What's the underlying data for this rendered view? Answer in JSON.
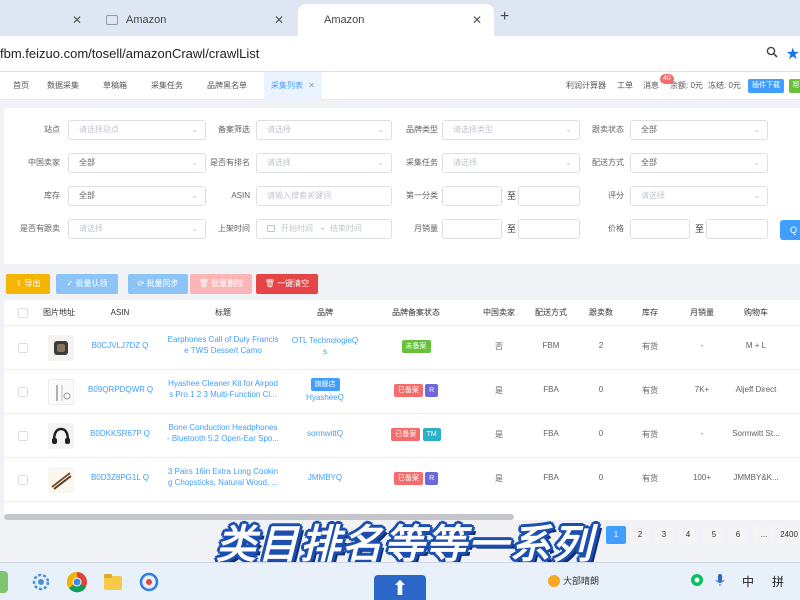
{
  "browser": {
    "tabs": [
      {
        "title": "",
        "close": "✕"
      },
      {
        "title": "Amazon",
        "close": "✕"
      },
      {
        "title": "Amazon",
        "close": "✕"
      }
    ],
    "new_tab": "+",
    "url": "fbm.feizuo.com/tosell/amazonCrawl/crawlList"
  },
  "nav": {
    "tabs": [
      "首页",
      "数据采集",
      "草稿箱",
      "采集任务",
      "品牌黑名单",
      "采集列表"
    ],
    "active_close": "✕",
    "profit_calc": "利润计算器",
    "orders": "工单",
    "messages": "消息",
    "message_badge": "40",
    "balance": "余额: 0元",
    "frozen": "冻结: 0元",
    "download_btn": "插件下载",
    "help_btn": "帮"
  },
  "filters": {
    "row1": [
      {
        "label": "站点",
        "placeholder": "请选择站点"
      },
      {
        "label": "备案筛选",
        "placeholder": "请选择"
      },
      {
        "label": "品牌类型",
        "placeholder": "请选择类型"
      },
      {
        "label": "跟卖状态",
        "value": "全部"
      }
    ],
    "row2": [
      {
        "label": "中国卖家",
        "value": "全部"
      },
      {
        "label": "是否有排名",
        "placeholder": "请选择"
      },
      {
        "label": "采集任务",
        "placeholder": "请选择"
      },
      {
        "label": "配送方式",
        "value": "全部"
      }
    ],
    "row3": [
      {
        "label": "库存",
        "value": "全部"
      },
      {
        "label": "ASIN",
        "placeholder": "请输入搜索关键词"
      },
      {
        "label": "第一分类",
        "sep": "至"
      },
      {
        "label": "评分",
        "placeholder": "请选择"
      }
    ],
    "row4": [
      {
        "label": "是否有跟卖",
        "placeholder": "请选择"
      },
      {
        "label": "上架时间",
        "start": "开始时间",
        "dash": "-",
        "end": "结束时间"
      },
      {
        "label": "月销量",
        "sep": "至"
      },
      {
        "label": "价格",
        "sep": "至"
      }
    ],
    "search_icon": "Q"
  },
  "actions": {
    "export": "导出",
    "batch_claim": "批量认领",
    "batch_sync": "批量同步",
    "batch_delete": "批量删除",
    "clear_all": "一键清空",
    "colors": {
      "export": "#f5b400",
      "claim": "#8cc4f8",
      "sync": "#8cc4f8",
      "delete": "#fab6b6",
      "clear": "#e64545"
    }
  },
  "table": {
    "headers": [
      "图片地址",
      "ASIN",
      "标题",
      "品牌",
      "品牌备案状态",
      "中国卖家",
      "配送方式",
      "跟卖数",
      "库存",
      "月销量",
      "购物车"
    ],
    "rows": [
      {
        "asin": "B0CJVLJ7DZ",
        "title1": "Earphones Call of Duty Francis",
        "title2": "e TWS Dessert Camo",
        "brand_line1": "OTL Technologie",
        "brand_line2": "s",
        "brand_tag": "",
        "status": "未备案",
        "status_color": "green",
        "extra_tag": "",
        "cn_seller": "否",
        "ship": "FBM",
        "follow": "2",
        "stock": "有货",
        "monthly": "-",
        "cart": "M + L"
      },
      {
        "asin": "B09QRPDQWR",
        "title1": "Hyashee Cleaner Kit for Airpod",
        "title2": "s Pro 1 2 3 Multi-Function Cl...",
        "brand_line1": "Hyashee",
        "brand_line2": "",
        "brand_tag": "旗舰店",
        "status": "已备案",
        "status_color": "red",
        "extra_tag": "R",
        "cn_seller": "是",
        "ship": "FBA",
        "follow": "0",
        "stock": "有货",
        "monthly": "7K+",
        "cart": "Aljeff Direct"
      },
      {
        "asin": "B0DKKSR67P",
        "title1": "Bone Conduction Headphones",
        "title2": "- Bluetooth 5.2 Open-Ear Spo...",
        "brand_line1": "sormwitt",
        "brand_line2": "",
        "brand_tag": "",
        "status": "已备案",
        "status_color": "red",
        "extra_tag": "TM",
        "cn_seller": "是",
        "ship": "FBA",
        "follow": "0",
        "stock": "有货",
        "monthly": "-",
        "cart": "Sormwitt St..."
      },
      {
        "asin": "B0D3Z8PG1L",
        "title1": "3 Pairs 16in Extra Long Cookin",
        "title2": "g Chopsticks, Natural Wood, ...",
        "brand_line1": "JMMBY",
        "brand_line2": "",
        "brand_tag": "",
        "status": "已备案",
        "status_color": "red",
        "extra_tag": "R",
        "cn_seller": "是",
        "ship": "FBA",
        "follow": "0",
        "stock": "有货",
        "monthly": "100+",
        "cart": "JMMBY&K..."
      }
    ],
    "link_icon": "Q"
  },
  "pagination": {
    "pages": [
      "1",
      "2",
      "3",
      "4",
      "5",
      "6",
      "...",
      "2400"
    ],
    "current": "1"
  },
  "caption": "类目排名等等一系列",
  "taskbar": {
    "weather": "大部晴朗",
    "ime1": "中",
    "ime2": "拼",
    "up": "⬆"
  }
}
